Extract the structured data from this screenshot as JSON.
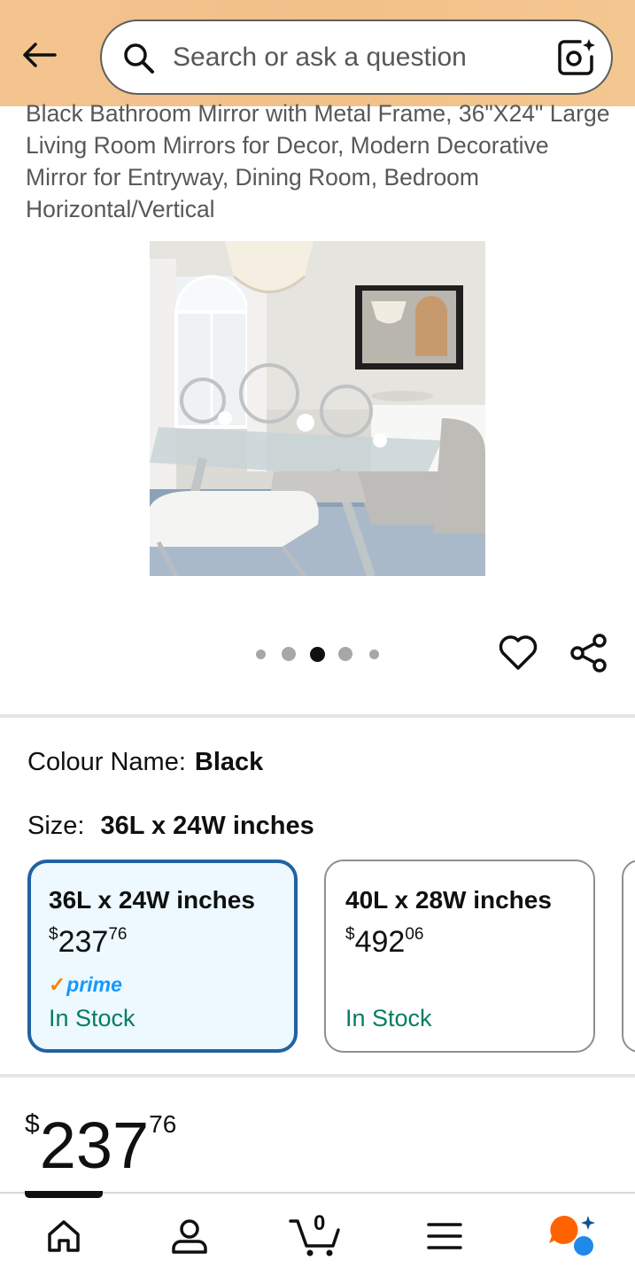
{
  "search": {
    "placeholder": "Search or ask a question"
  },
  "product": {
    "title": "Black Bathroom Mirror with Metal Frame, 36\"X24\" Large Living Room Mirrors for Decor, Modern Decorative Mirror for Entryway, Dining Room, Bedroom Horizontal/Vertical",
    "image_count": 5,
    "active_image_index": 2
  },
  "colour": {
    "label": "Colour Name:",
    "value": "Black"
  },
  "size": {
    "label": "Size:",
    "value": "36L x 24W inches",
    "options": [
      {
        "label": "36L x 24W inches",
        "currency": "$",
        "whole": "237",
        "cents": "76",
        "prime_label": "prime",
        "stock": "In Stock",
        "selected": true
      },
      {
        "label": "40L x 28W inches",
        "currency": "$",
        "whole": "492",
        "cents": "06",
        "stock": "In Stock",
        "selected": false
      }
    ]
  },
  "price": {
    "currency": "$",
    "whole": "237",
    "cents": "76"
  },
  "nav": {
    "cart_count": "0",
    "items": [
      "home-icon",
      "account-icon",
      "cart-icon",
      "menu-icon",
      "rufus-icon"
    ]
  },
  "colors": {
    "header_bg": "#f3c38e",
    "selected_border": "#2162a1",
    "selected_bg": "#edf8ff",
    "stock_green": "#067d62",
    "prime_blue": "#1399ff",
    "accent_orange": "#ff6200"
  }
}
